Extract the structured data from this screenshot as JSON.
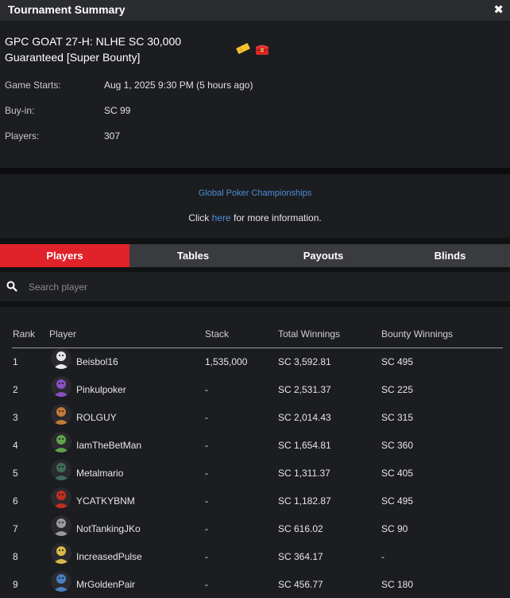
{
  "window": {
    "title": "Tournament Summary"
  },
  "tournament": {
    "name": "GPC GOAT 27-H: NLHE SC 30,000 Guaranteed [Super Bounty]",
    "game_starts_label": "Game Starts:",
    "game_starts_value": "Aug 1, 2025 9:30 PM (5 hours ago)",
    "buyin_label": "Buy-in:",
    "buyin_value": "SC 99",
    "players_label": "Players:",
    "players_value": "307"
  },
  "promo": {
    "link_text": "Global Poker Championships",
    "click_prefix": "Click",
    "here": "here",
    "click_suffix": "for more information."
  },
  "tabs": [
    {
      "label": "Players",
      "active": true
    },
    {
      "label": "Tables",
      "active": false
    },
    {
      "label": "Payouts",
      "active": false
    },
    {
      "label": "Blinds",
      "active": false
    }
  ],
  "search": {
    "placeholder": "Search player"
  },
  "table": {
    "headers": {
      "rank": "Rank",
      "player": "Player",
      "stack": "Stack",
      "total": "Total Winnings",
      "bounty": "Bounty Winnings"
    },
    "rows": [
      {
        "rank": "1",
        "player": "Beisbol16",
        "stack": "1,535,000",
        "total": "SC 3,592.81",
        "bounty": "SC 495",
        "avatar_color": "#e8e8e8"
      },
      {
        "rank": "2",
        "player": "Pinkulpoker",
        "stack": "-",
        "total": "SC 2,531.37",
        "bounty": "SC 225",
        "avatar_color": "#8a4fc4"
      },
      {
        "rank": "3",
        "player": "ROLGUY",
        "stack": "-",
        "total": "SC 2,014.43",
        "bounty": "SC 315",
        "avatar_color": "#c07a3a"
      },
      {
        "rank": "4",
        "player": "IamTheBetMan",
        "stack": "-",
        "total": "SC 1,654.81",
        "bounty": "SC 360",
        "avatar_color": "#5fa34a"
      },
      {
        "rank": "5",
        "player": "Metalmario",
        "stack": "-",
        "total": "SC 1,311.37",
        "bounty": "SC 405",
        "avatar_color": "#3f6b5a"
      },
      {
        "rank": "6",
        "player": "YCATKYBNM",
        "stack": "-",
        "total": "SC 1,182.87",
        "bounty": "SC 495",
        "avatar_color": "#c0301f"
      },
      {
        "rank": "7",
        "player": "NotTankingJKo",
        "stack": "-",
        "total": "SC 616.02",
        "bounty": "SC 90",
        "avatar_color": "#9a9a9a"
      },
      {
        "rank": "8",
        "player": "IncreasedPulse",
        "stack": "-",
        "total": "SC 364.17",
        "bounty": "-",
        "avatar_color": "#d9b94a"
      },
      {
        "rank": "9",
        "player": "MrGoldenPair",
        "stack": "-",
        "total": "SC 456.77",
        "bounty": "SC 180",
        "avatar_color": "#4a7fc0"
      }
    ]
  },
  "colors": {
    "accent_red": "#e0222b",
    "link_blue": "#4a90d9",
    "panel": "#1c1d20"
  }
}
